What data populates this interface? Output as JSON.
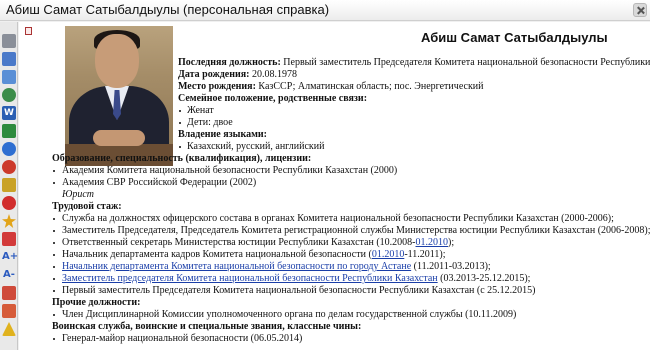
{
  "window": {
    "title": "Абиш Самат Сатыбалдыулы (персональная справка)"
  },
  "toolbar": {
    "icons": [
      "pages-icon",
      "copy-icon",
      "print-icon",
      "globe-icon",
      "word-icon",
      "excel-icon",
      "info-icon",
      "help-icon",
      "book-icon",
      "stop-icon",
      "star-icon",
      "bookmark-icon",
      "font-increase-icon",
      "font-decrease-icon",
      "arrow-icon",
      "flag-icon",
      "warning-icon"
    ],
    "labels": {
      "font_increase": "A+",
      "font_decrease": "A-",
      "word": "W"
    }
  },
  "profile": {
    "name": "Абиш Самат Сатыбалдыулы",
    "last_position_label": "Последняя должность:",
    "last_position": "Первый заместитель Председателя Комитета национальной безопасности Республики Казахстан",
    "birth_date_label": "Дата рождения:",
    "birth_date": "20.08.1978",
    "birth_place_label": "Место рождения:",
    "birth_place": "КазССР; Алматинская область; пос. Энергетический",
    "family_label": "Семейное положение, родственные связи:",
    "family": [
      "Женат",
      "Дети: двое"
    ],
    "languages_label": "Владение языками:",
    "languages": [
      "Казахский, русский, английский"
    ]
  },
  "education": {
    "label": "Образование, специальность (квалификация), лицензии:",
    "items": [
      "Академия Комитета национальной безопасности Республики Казахстан (2000)",
      "Академия СВР Российской Федерации (2002)"
    ],
    "specialty": "Юрист"
  },
  "career": {
    "label": "Трудовой стаж:",
    "items": [
      {
        "text": "Служба на должностях офицерского состава в органах Комитета национальной безопасности Республики Казахстан (2000-2006);"
      },
      {
        "text": "Заместитель Председателя, Председатель Комитета регистрационной службы Министерства юстиции Республики Казахстан (2006-2008);"
      },
      {
        "text_before": "Ответственный секретарь Министерства юстиции Республики Казахстан (10.2008-",
        "link": "01.2010",
        "text_after": ");"
      },
      {
        "text_before": "Начальник департамента кадров Комитета национальной безопасности (",
        "link": "01.2010",
        "text_after": "-11.2011);"
      },
      {
        "link": "Начальник департамента Комитета национальной безопасности по городу Астане",
        "text_after": " (11.2011-03.2013);"
      },
      {
        "link": "Заместитель председателя Комитета национальной безопасности Республики Казахстан",
        "text_after": " (03.2013-25.12.2015);"
      },
      {
        "text": "Первый заместитель Председателя Комитета национальной безопасности Республики Казахстан (с 25.12.2015)"
      }
    ]
  },
  "other_positions": {
    "label": "Прочие должности:",
    "items": [
      "Член Дисциплинарной Комиссии уполномоченного органа по делам государственной службы (10.11.2009)"
    ]
  },
  "military": {
    "label": "Воинская служба, воинские и специальные звания, классные чины:",
    "items": [
      "Генерал-майор национальной безопасности (06.05.2014)"
    ]
  },
  "colors": {
    "link": "#1a3ea8",
    "background": "#ffffff",
    "chrome": "#f0f0f0"
  }
}
